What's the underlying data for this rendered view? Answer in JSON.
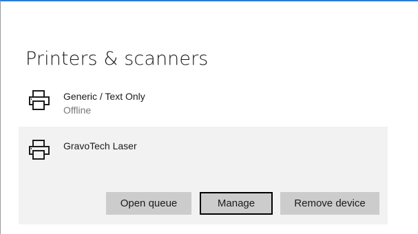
{
  "page": {
    "title": "Printers & scanners"
  },
  "devices": [
    {
      "name": "Generic / Text Only",
      "status": "Offline",
      "icon": "printer-icon"
    },
    {
      "name": "GravoTech Laser",
      "icon": "printer-icon",
      "selected": true
    }
  ],
  "actions": {
    "open_queue": "Open queue",
    "manage": "Manage",
    "remove_device": "Remove device"
  },
  "colors": {
    "accent_border": "#2b7bd4",
    "selected_bg": "#f2f2f2",
    "button_bg": "#cccccc",
    "secondary_text": "#767676"
  }
}
